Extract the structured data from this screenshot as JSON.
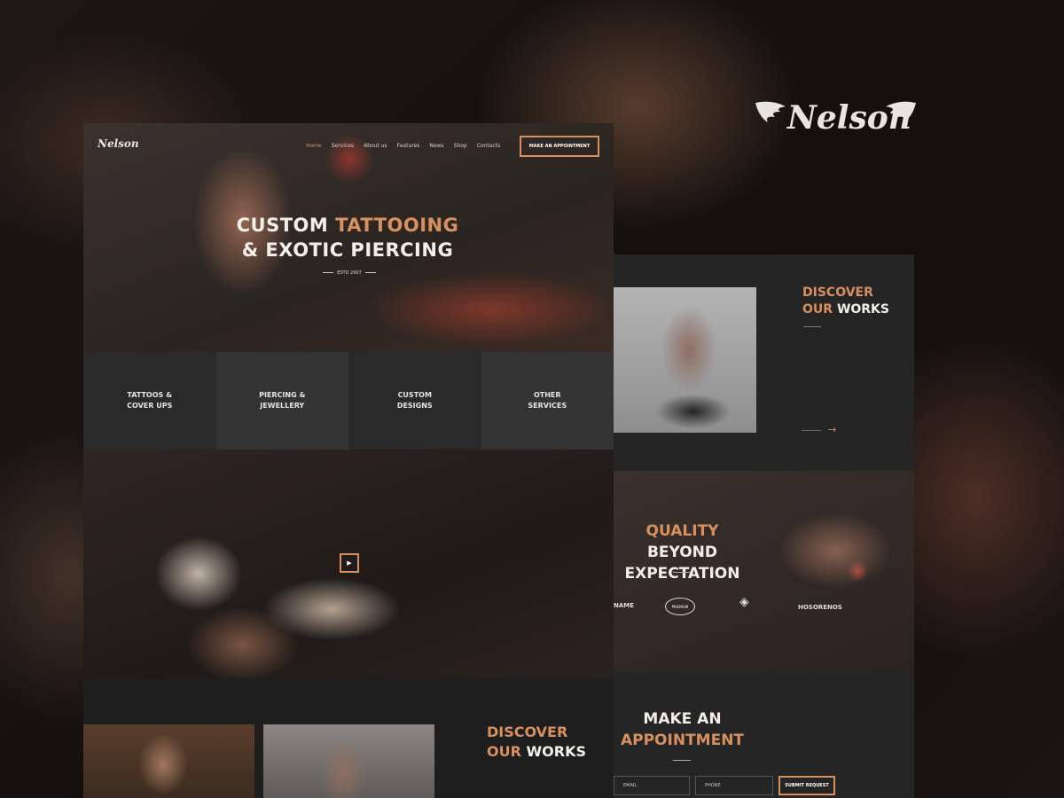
{
  "brand": {
    "name": "Nelson"
  },
  "nav": {
    "items": [
      "Home",
      "Services",
      "About us",
      "Features",
      "News",
      "Shop",
      "Contacts"
    ],
    "active": "Home",
    "cta": "MAKE AN APPOINTMENT"
  },
  "hero": {
    "title_line1_a": "CUSTOM",
    "title_line1_b": "TATTOOING",
    "title_line2": "& EXOTIC PIERCING",
    "estd": "ESTD 2007"
  },
  "services": [
    {
      "line1": "TATTOOS &",
      "line2": "COVER UPS"
    },
    {
      "line1": "PIERCING &",
      "line2": "JEWELLERY"
    },
    {
      "line1": "CUSTOM",
      "line2": "DESIGNS"
    },
    {
      "line1": "OTHER",
      "line2": "SERVICES"
    }
  ],
  "video": {
    "play_icon": "play-icon"
  },
  "works": {
    "line1": "DISCOVER",
    "line2_a": "OUR",
    "line2_b": "WORKS",
    "next_arrow": "→"
  },
  "quality": {
    "line1_a": "QUALITY",
    "line1_b": "BEYOND",
    "line2": "EXPECTATION"
  },
  "brands": [
    "NAME",
    "PREMIUM",
    "HOSORENOS"
  ],
  "appointment": {
    "line1": "MAKE AN",
    "line2": "APPOINTMENT",
    "email_placeholder": "EMAIL",
    "phone_placeholder": "PHONE",
    "submit": "SUBMIT REQUEST"
  },
  "colors": {
    "accent": "#d7905e",
    "background": "#15110f",
    "panel": "#252525"
  }
}
